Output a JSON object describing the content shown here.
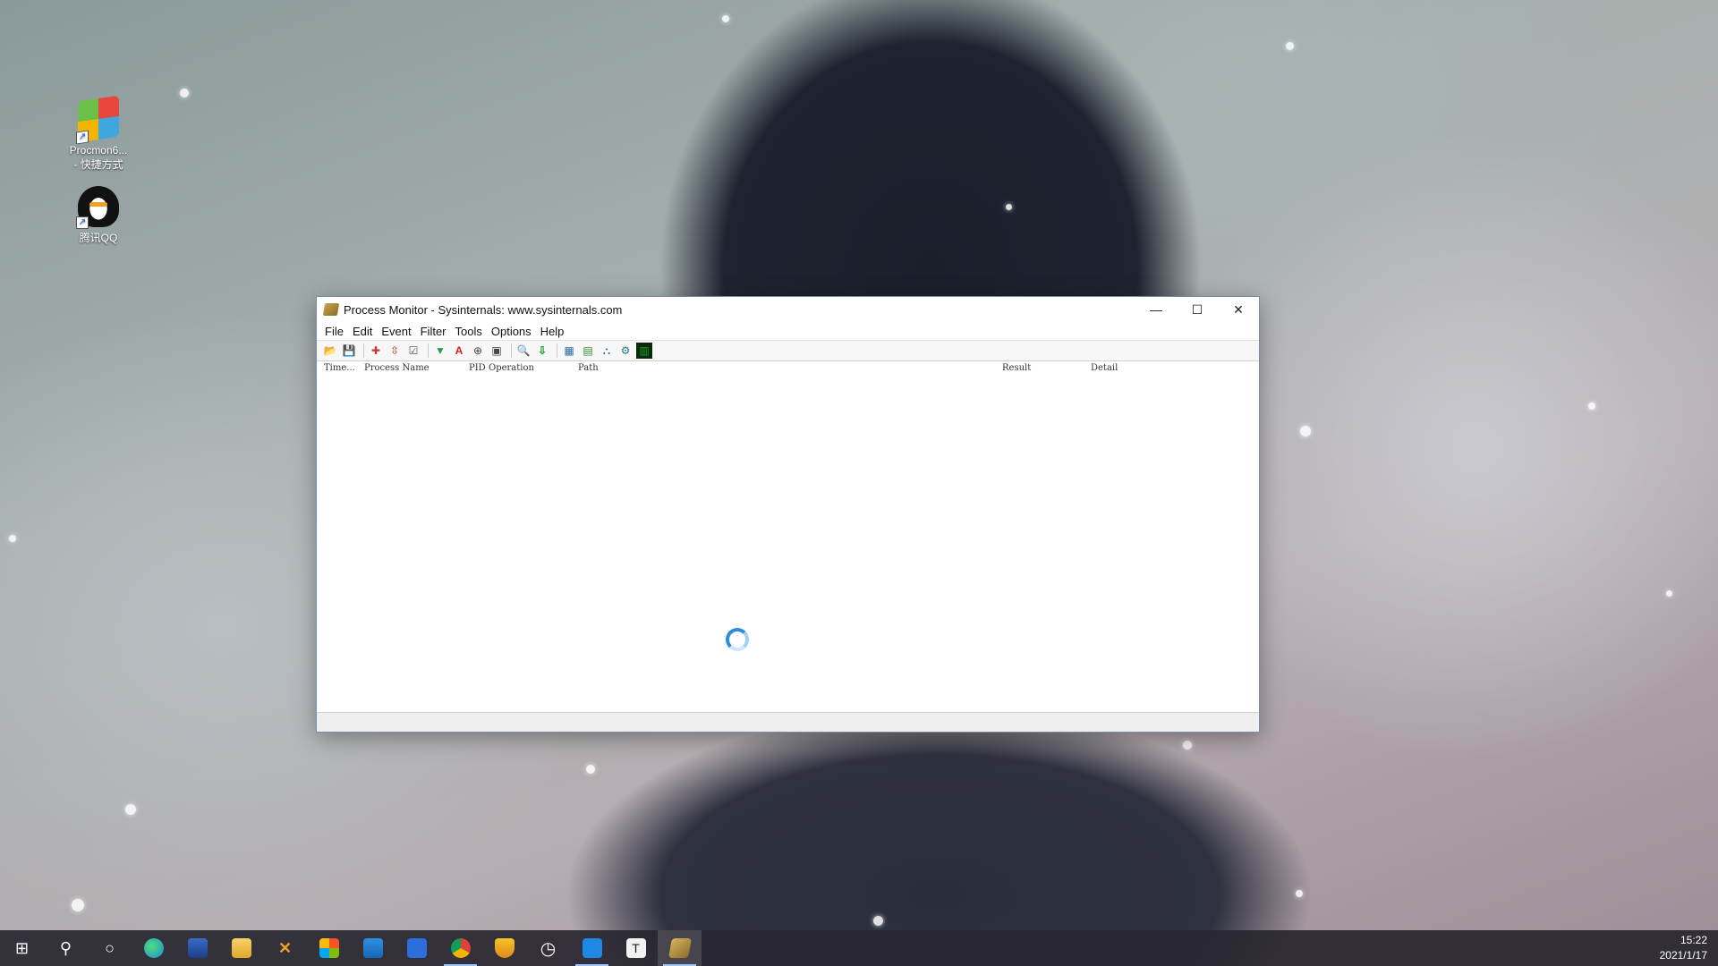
{
  "desktop": {
    "icons": [
      {
        "label_line1": "Procmon6...",
        "label_line2": "- 快捷方式",
        "icon": "procmon-shortcut-icon"
      },
      {
        "label": "腾讯QQ",
        "icon": "qq-penguin-icon"
      }
    ]
  },
  "window": {
    "title": "Process Monitor - Sysinternals: www.sysinternals.com",
    "controls": {
      "minimize": "—",
      "maximize": "☐",
      "close": "✕"
    },
    "menu": [
      "File",
      "Edit",
      "Event",
      "Filter",
      "Tools",
      "Options",
      "Help"
    ],
    "toolbar": [
      {
        "icon": "open-icon",
        "glyph": "📂"
      },
      {
        "icon": "save-icon",
        "glyph": "💾"
      },
      {
        "icon": "capture-icon",
        "glyph": "✚"
      },
      {
        "icon": "autoscroll-icon",
        "glyph": "⇳"
      },
      {
        "icon": "clear-icon",
        "glyph": "☑"
      },
      {
        "icon": "filter-icon",
        "glyph": "▼"
      },
      {
        "icon": "highlight-icon",
        "glyph": "A"
      },
      {
        "icon": "target-icon",
        "glyph": "⊕"
      },
      {
        "icon": "process-tree-icon",
        "glyph": "▣"
      },
      {
        "icon": "find-icon",
        "glyph": "🔍"
      },
      {
        "icon": "jump-icon",
        "glyph": "⇩"
      },
      {
        "icon": "registry-icon",
        "glyph": "▦"
      },
      {
        "icon": "filesystem-icon",
        "glyph": "▤"
      },
      {
        "icon": "network-icon",
        "glyph": "⛬"
      },
      {
        "icon": "process-activity-icon",
        "glyph": "⚙"
      },
      {
        "icon": "profiling-icon",
        "glyph": "▥"
      }
    ],
    "columns": {
      "time": "Time...",
      "process_name": "Process Name",
      "pid": "PID",
      "operation": "Operation",
      "path": "Path",
      "result": "Result",
      "detail": "Detail"
    }
  },
  "taskbar": {
    "clock_time": "15:22",
    "clock_date": "2021/1/17"
  }
}
